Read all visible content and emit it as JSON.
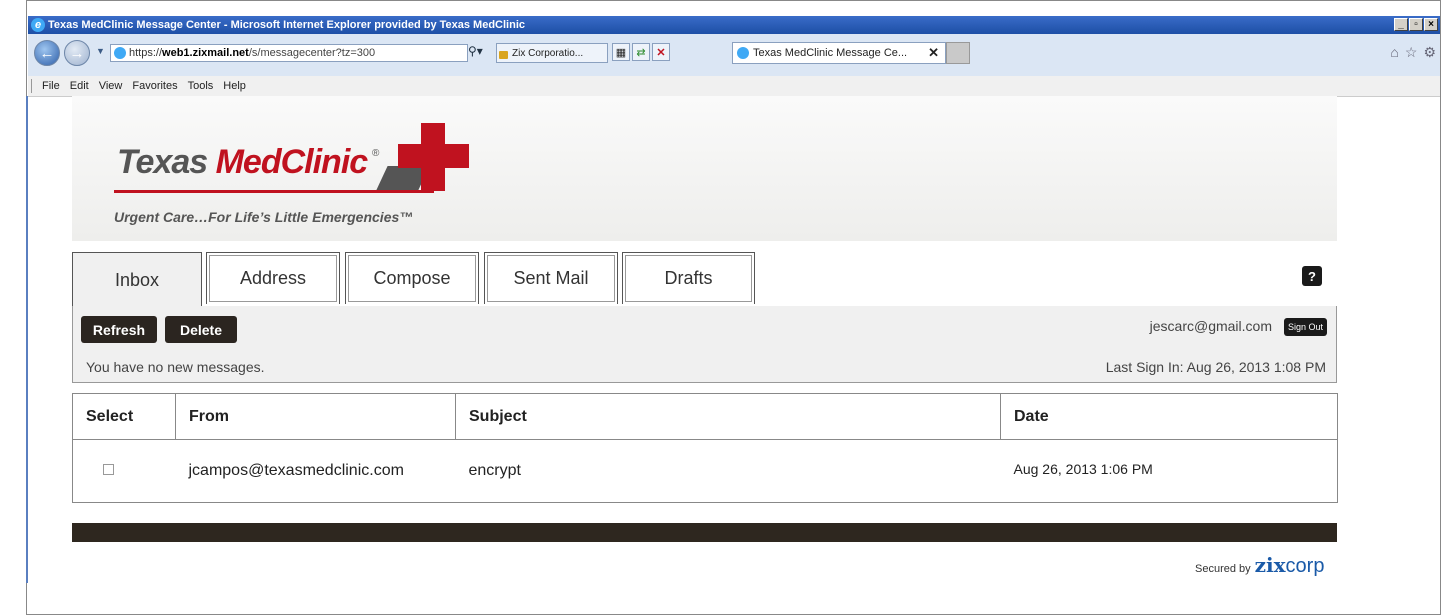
{
  "browser": {
    "window_title": "Texas MedClinic Message Center - Microsoft Internet Explorer provided by Texas MedClinic",
    "address": {
      "protocol": "https://",
      "host": "web1.zixmail.net",
      "path": "/s/messagecenter?tz=300"
    },
    "security_label": "Zix Corporatio...",
    "tab_title": "Texas MedClinic Message Ce...",
    "menu": [
      "File",
      "Edit",
      "View",
      "Favorites",
      "Tools",
      "Help"
    ],
    "window_controls": [
      "_",
      "▫",
      "×"
    ]
  },
  "brand": {
    "name_part1": "Texas",
    "name_part2": "MedClinic",
    "registered": "®",
    "tagline": "Urgent Care…For Life’s Little Emergencies™",
    "brand_color": "#c0121f"
  },
  "tabs": [
    {
      "label": "Inbox",
      "active": true
    },
    {
      "label": "Address",
      "active": false
    },
    {
      "label": "Compose",
      "active": false
    },
    {
      "label": "Sent Mail",
      "active": false
    },
    {
      "label": "Drafts",
      "active": false
    }
  ],
  "help_label": "?",
  "actions": {
    "refresh": "Refresh",
    "delete": "Delete",
    "status": "You have no new messages.",
    "user_email": "jescarc@gmail.com",
    "sign_out": "Sign Out",
    "last_sign_in": "Last Sign In: Aug 26, 2013 1:08 PM"
  },
  "table": {
    "headers": [
      "Select",
      "From",
      "Subject",
      "Date"
    ],
    "rows": [
      {
        "from": "jcampos@texasmedclinic.com",
        "subject": "encrypt",
        "date": "Aug 26, 2013 1:06 PM",
        "selected": false
      }
    ]
  },
  "footer": {
    "secured_by": "Secured by",
    "zix": "zix",
    "corp": "corp"
  }
}
